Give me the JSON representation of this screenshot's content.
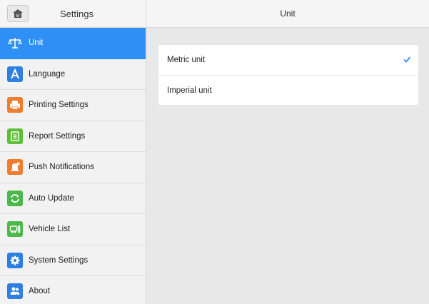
{
  "sidebar": {
    "title": "Settings",
    "items": [
      {
        "label": "Unit",
        "icon": "scale-icon",
        "color": "#2f8ff5",
        "active": true
      },
      {
        "label": "Language",
        "icon": "letter-a-icon",
        "color": "#2f7fe0"
      },
      {
        "label": "Printing Settings",
        "icon": "printer-icon",
        "color": "#f07d2f"
      },
      {
        "label": "Report Settings",
        "icon": "report-icon",
        "color": "#5cbf3a"
      },
      {
        "label": "Push Notifications",
        "icon": "bell-icon",
        "color": "#f07d2f"
      },
      {
        "label": "Auto Update",
        "icon": "refresh-icon",
        "color": "#4cb84a"
      },
      {
        "label": "Vehicle List",
        "icon": "vehicle-list-icon",
        "color": "#4cb84a"
      },
      {
        "label": "System Settings",
        "icon": "gear-icon",
        "color": "#2f7fe0"
      },
      {
        "label": "About",
        "icon": "people-icon",
        "color": "#2f7fe0"
      }
    ]
  },
  "main": {
    "title": "Unit",
    "options": [
      {
        "label": "Metric unit",
        "selected": true
      },
      {
        "label": "Imperial unit",
        "selected": false
      }
    ]
  },
  "colors": {
    "accent": "#2f8ff5",
    "check": "#2f8ff5"
  }
}
